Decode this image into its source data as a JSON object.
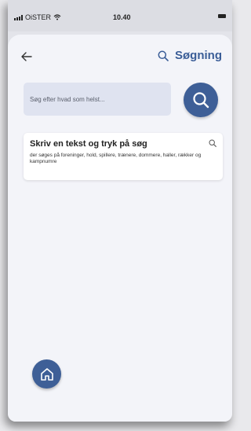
{
  "status_bar": {
    "carrier": "OiSTER",
    "time": "10.40"
  },
  "header": {
    "back_icon": "arrow-left-icon",
    "search_icon": "search-icon",
    "title": "Søgning"
  },
  "search": {
    "placeholder": "Søg efter hvad som helst..."
  },
  "hint_card": {
    "title": "Skriv en tekst og tryk på søg",
    "description": "der søges på foreninger, hold, spillere, trænere, dommere, haller, rækker og kampnumre"
  },
  "colors": {
    "accent": "#3e5f97",
    "field": "#dfe3f0",
    "background": "#f3f4f9"
  }
}
